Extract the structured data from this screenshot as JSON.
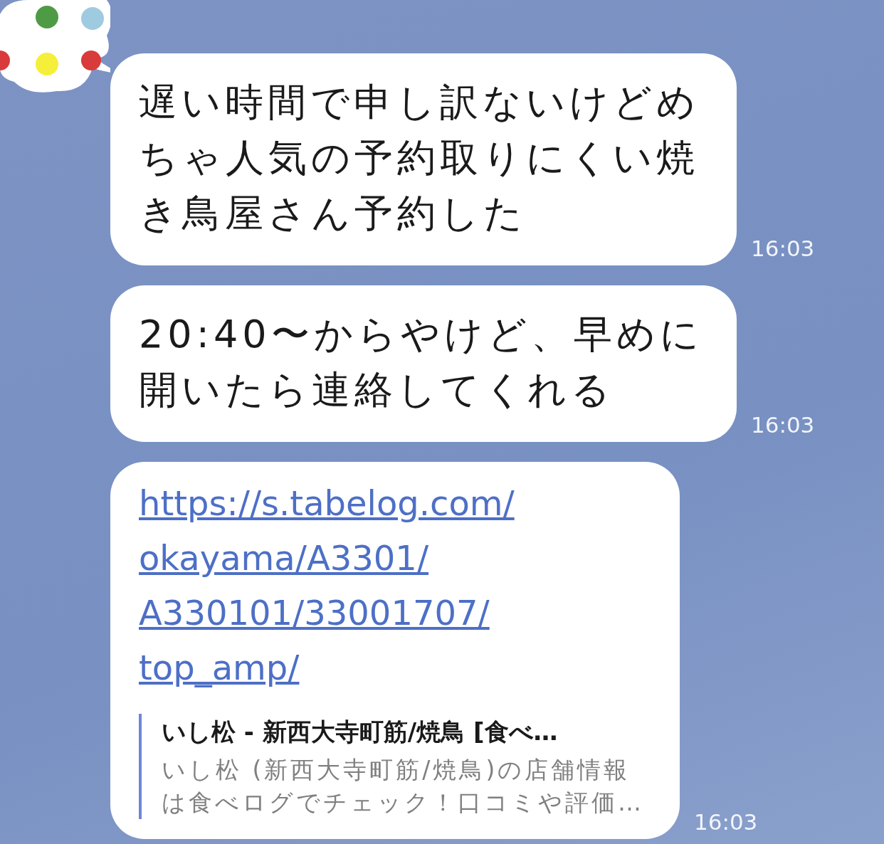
{
  "messages": [
    {
      "kind": "text",
      "text": "遅い時間で申し訳ないけどめちゃ人気の予約取りにくい焼き鳥屋さん予約した",
      "time": "16:03"
    },
    {
      "kind": "text",
      "text": "20:40〜からやけど、早めに開いたら連絡してくれる",
      "time": "16:03"
    },
    {
      "kind": "link",
      "url": "https://s.tabelog.com/\nokayama/A3301/\nA330101/33001707/\ntop_amp/",
      "preview": {
        "title": "いし松 - 新西大寺町筋/焼鳥 [食べ…",
        "description": "いし松 (新西大寺町筋/焼鳥)の店舗情報は食べログでチェック！口コミや評価…"
      },
      "time": "16:03"
    }
  ]
}
